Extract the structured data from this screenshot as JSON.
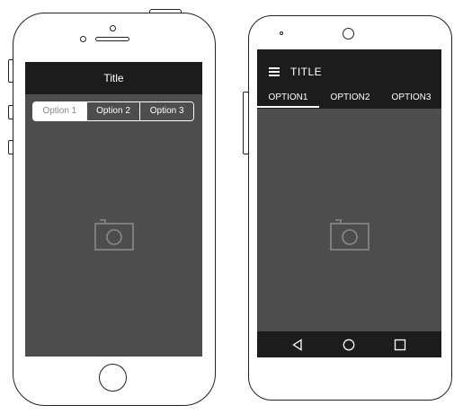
{
  "ios": {
    "title": "Title",
    "segments": [
      "Option 1",
      "Option 2",
      "Option 3"
    ],
    "active_segment": "Option 1",
    "placeholder_icon": "camera-icon"
  },
  "android": {
    "title": "TITLE",
    "menu_icon": "menu-icon",
    "tabs": [
      "OPTION1",
      "OPTION2",
      "OPTION3"
    ],
    "active_tab": "OPTION1",
    "placeholder_icon": "camera-icon",
    "nav_icons": [
      "back-icon",
      "home-icon",
      "recents-icon"
    ]
  },
  "colors": {
    "bar": "#1c1c1c",
    "screen": "#4d4d4d",
    "outline": "#222222",
    "text": "#ffffff"
  }
}
